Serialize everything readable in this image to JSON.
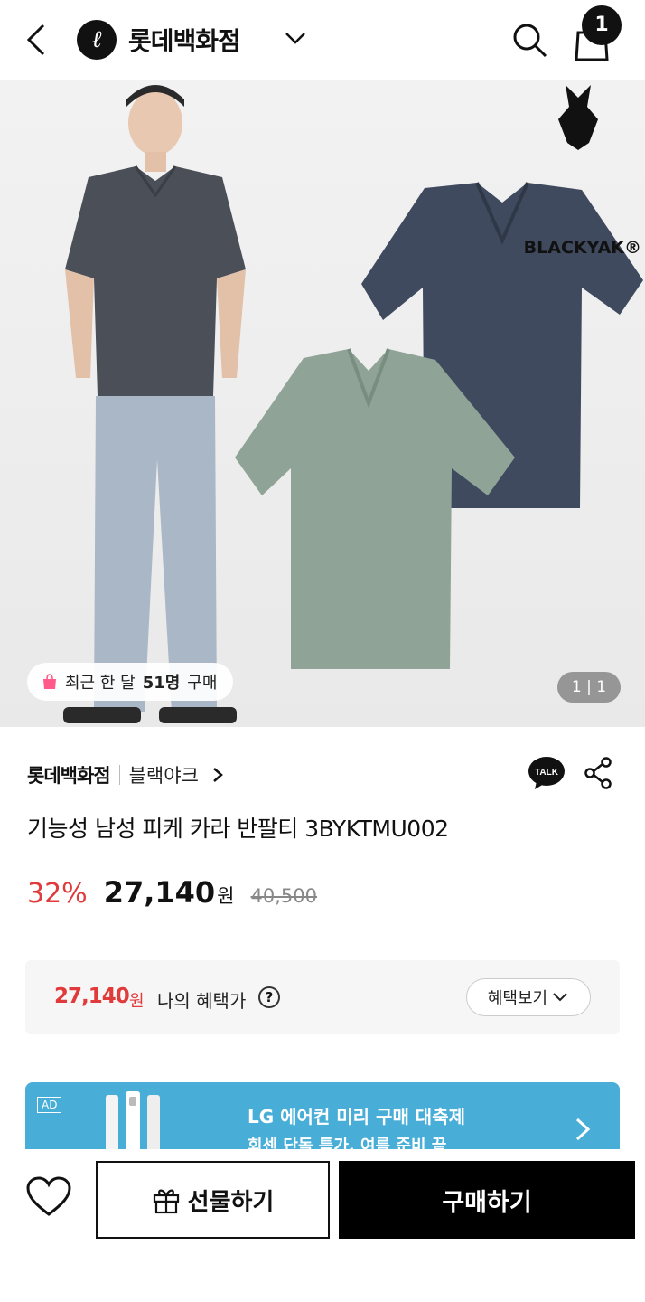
{
  "header": {
    "store_name": "롯데백화점",
    "logo_letter": "ℓ",
    "cart_count": "1",
    "icons": [
      "back-icon",
      "chevron-down-icon",
      "search-icon",
      "cart-icon"
    ]
  },
  "hero": {
    "brand_logo": "BLACKYAK®",
    "recent_prefix": "최근 한 달",
    "recent_count": "51명",
    "recent_suffix": "구매",
    "pager": "1 | 1"
  },
  "product": {
    "store": "롯데백화점",
    "brand": "블랙야크",
    "talk_label": "TALK",
    "title": "기능성 남성 피케 카라 반팔티 3BYKTMU002",
    "discount": "32%",
    "price": "27,140",
    "currency": "원",
    "original_price": "40,500"
  },
  "benefit": {
    "price": "27,140",
    "currency": "원",
    "label": "나의 혜택가",
    "help": "?",
    "button_label": "혜택보기"
  },
  "ad": {
    "tag": "AD",
    "line1": "LG 에어컨 미리 구매 대축제",
    "line2": "회센 단독 특가, 여름 준비 끝"
  },
  "bottom": {
    "gift_label": "선물하기",
    "buy_label": "구매하기"
  },
  "colors": {
    "accent_red": "#e03a3a",
    "ad_blue": "#48aed8",
    "shirt_navy": "#3f4a5e",
    "shirt_sage": "#8fa397"
  }
}
